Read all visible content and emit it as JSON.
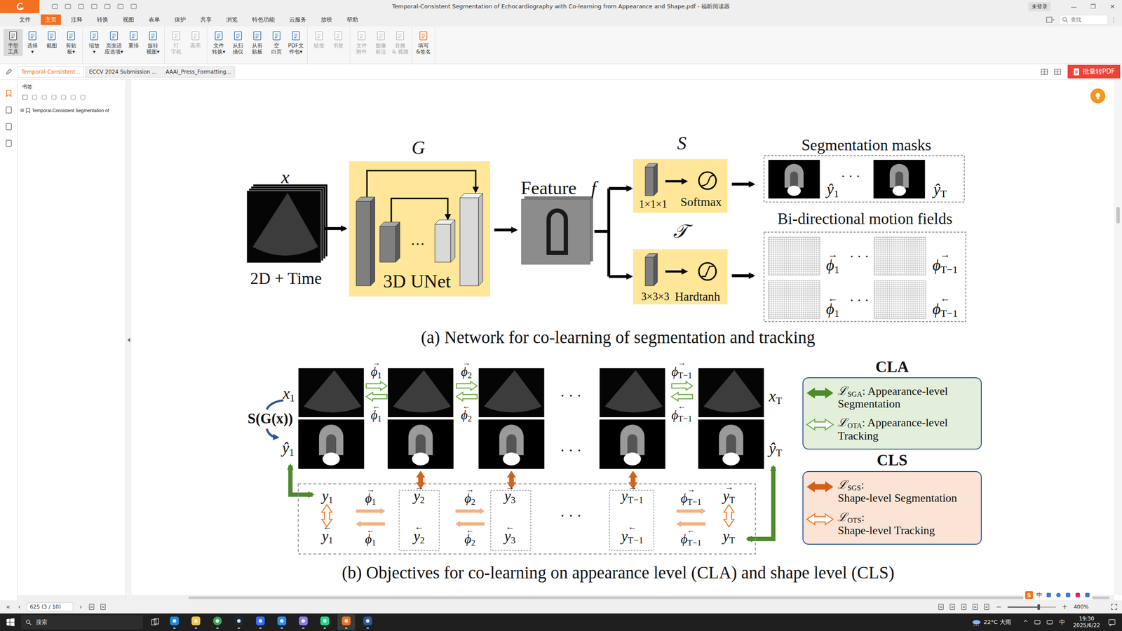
{
  "window": {
    "title": "Temporal-Consistent Segmentation of Echocardiography with Co-learning from Appearance and Shape.pdf - 福昕阅读器",
    "user": "未登录",
    "controls": [
      "—",
      "❐",
      "✕"
    ]
  },
  "menu": {
    "items": [
      {
        "label": "文件",
        "selected": false
      },
      {
        "label": "主页",
        "selected": true
      },
      {
        "label": "注释",
        "selected": false
      },
      {
        "label": "转换",
        "selected": false
      },
      {
        "label": "视图",
        "selected": false
      },
      {
        "label": "表单",
        "selected": false
      },
      {
        "label": "保护",
        "selected": false
      },
      {
        "label": "共享",
        "selected": false
      },
      {
        "label": "浏览",
        "selected": false
      },
      {
        "label": "特色功能",
        "selected": false
      },
      {
        "label": "云服务",
        "selected": false
      },
      {
        "label": "放映",
        "selected": false
      },
      {
        "label": "帮助",
        "selected": false
      }
    ],
    "search": {
      "placeholder": "查找"
    },
    "more": "⋮"
  },
  "ribbon": {
    "groups": [
      [
        {
          "lines": [
            "手型",
            "工具"
          ],
          "selected": true,
          "disabled": false
        },
        {
          "lines": [
            "选择",
            "▾"
          ],
          "selected": false,
          "disabled": false
        },
        {
          "lines": [
            "截图"
          ],
          "selected": false,
          "disabled": false
        },
        {
          "lines": [
            "剪贴",
            "板▾"
          ],
          "selected": false,
          "disabled": false
        }
      ],
      [
        {
          "lines": [
            "缩放",
            "▾"
          ],
          "selected": false,
          "disabled": false
        },
        {
          "lines": [
            "页面适",
            "应选项▾"
          ],
          "selected": false,
          "disabled": false
        },
        {
          "lines": [
            "重排"
          ],
          "selected": false,
          "disabled": false
        },
        {
          "lines": [
            "旋转",
            "视图▾"
          ],
          "selected": false,
          "disabled": false
        }
      ],
      [
        {
          "lines": [
            "打",
            "字机"
          ],
          "selected": false,
          "disabled": true
        },
        {
          "lines": [
            "高亮"
          ],
          "selected": false,
          "disabled": true
        }
      ],
      [
        {
          "lines": [
            "文件",
            "转换▾"
          ],
          "selected": false,
          "disabled": false
        },
        {
          "lines": [
            "从扫",
            "描仪"
          ],
          "selected": false,
          "disabled": false
        },
        {
          "lines": [
            "从剪",
            "贴板"
          ],
          "selected": false,
          "disabled": false
        },
        {
          "lines": [
            "空",
            "白页"
          ],
          "selected": false,
          "disabled": false
        },
        {
          "lines": [
            "PDF文",
            "件包▾"
          ],
          "selected": false,
          "disabled": false
        }
      ],
      [
        {
          "lines": [
            "链接"
          ],
          "selected": false,
          "disabled": true
        },
        {
          "lines": [
            "书签"
          ],
          "selected": false,
          "disabled": true
        }
      ],
      [
        {
          "lines": [
            "文件",
            "附件"
          ],
          "selected": false,
          "disabled": true
        },
        {
          "lines": [
            "图像",
            "标注"
          ],
          "selected": false,
          "disabled": true
        },
        {
          "lines": [
            "音频",
            "& 视频"
          ],
          "selected": false,
          "disabled": true
        }
      ],
      [
        {
          "lines": [
            "填写",
            "&签名"
          ],
          "selected": false,
          "disabled": false
        }
      ]
    ]
  },
  "tabs": {
    "items": [
      {
        "label": "Temporal-Consistent...",
        "selected": true
      },
      {
        "label": "ECCV 2024 Submission ...",
        "selected": false
      },
      {
        "label": "AAAI_Press_Formatting...",
        "selected": false
      }
    ],
    "convert_button": "批量转PDF"
  },
  "sidebar": {
    "panel_title": "书签",
    "tree": [
      {
        "label": "Temporal-Consistent Segmentation of",
        "expander": "⊞",
        "expanded": false
      }
    ]
  },
  "figure": {
    "a": {
      "input_symbol": "x",
      "input_label": "2D + Time",
      "g_symbol": "G",
      "unet_label": "3D UNet",
      "unet_dots": "…",
      "feature_label": "Feature",
      "feature_symbol": "f",
      "s_symbol": "S",
      "s_kernel": "1×1×1",
      "s_activation": "Softmax",
      "t_symbol": "𝒯",
      "t_kernel": "3×3×3",
      "t_activation": "Hardtanh",
      "seg_title": "Segmentation masks",
      "seg_first": {
        "sym": "ŷ",
        "sub": "1"
      },
      "seg_dots": "· · ·",
      "seg_last": {
        "sym": "ŷ",
        "sub": "T"
      },
      "motion_title": "Bi-directional motion fields",
      "motion_rows": [
        {
          "first": {
            "arrow": "→",
            "sym": "ϕ",
            "sub": "1"
          },
          "dots": "· · ·",
          "last": {
            "arrow": "→",
            "sym": "ϕ",
            "sub": "T−1"
          }
        },
        {
          "first": {
            "arrow": "←",
            "sym": "ϕ",
            "sub": "1"
          },
          "dots": "· · ·",
          "last": {
            "arrow": "←",
            "sym": "ϕ",
            "sub": "T−1"
          }
        }
      ],
      "caption": "(a) Network for co-learning of segmentation and tracking"
    },
    "b": {
      "x_first": {
        "sym": "x",
        "sub": "1"
      },
      "x_last": {
        "sym": "x",
        "sub": "T"
      },
      "y_first": {
        "sym": "ŷ",
        "sub": "1"
      },
      "y_last": {
        "sym": "ŷ",
        "sub": "T"
      },
      "sg_label": "S(G(x))",
      "top_links": [
        {
          "fwd": {
            "arrow": "→",
            "sym": "ϕ",
            "sub": "1"
          },
          "bwd": {
            "arrow": "←",
            "sym": "ϕ",
            "sub": "1"
          }
        },
        {
          "fwd": {
            "arrow": "→",
            "sym": "ϕ",
            "sub": "2"
          },
          "bwd": {
            "arrow": "←",
            "sym": "ϕ",
            "sub": "2"
          }
        },
        {
          "fwd": {
            "arrow": "→",
            "sym": "ϕ",
            "sub": "T−1"
          },
          "bwd": {
            "arrow": "←",
            "sym": "ϕ",
            "sub": "T−1"
          }
        }
      ],
      "dots": [
        "· · ·",
        "· · ·",
        "· · ·"
      ],
      "shape_columns": [
        {
          "top": {
            "sym": "y",
            "sub": "1"
          },
          "bottom": {
            "arrow": "←",
            "sym": "y",
            "sub": "1"
          }
        },
        {
          "top": {
            "arrow": "→",
            "sym": "y",
            "sub": "2"
          },
          "bottom": {
            "arrow": "←",
            "sym": "y",
            "sub": "2"
          }
        },
        {
          "top": {
            "arrow": "→",
            "sym": "y",
            "sub": "3"
          },
          "bottom": {
            "arrow": "←",
            "sym": "y",
            "sub": "3"
          }
        },
        {
          "top": {
            "arrow": "→",
            "sym": "y",
            "sub": "T−1"
          },
          "bottom": {
            "arrow": "←",
            "sym": "y",
            "sub": "T−1"
          }
        },
        {
          "top": {
            "arrow": "→",
            "sym": "y",
            "sub": "T"
          },
          "bottom": {
            "sym": "y",
            "sub": "T"
          }
        }
      ],
      "shape_links": [
        {
          "fwd": {
            "arrow": "→",
            "sym": "ϕ",
            "sub": "1"
          },
          "bwd": {
            "arrow": "←",
            "sym": "ϕ",
            "sub": "1"
          }
        },
        {
          "fwd": {
            "arrow": "→",
            "sym": "ϕ",
            "sub": "2"
          },
          "bwd": {
            "arrow": "←",
            "sym": "ϕ",
            "sub": "2"
          }
        },
        {
          "fwd": {
            "arrow": "→",
            "sym": "ϕ",
            "sub": "T−1"
          },
          "bwd": {
            "arrow": "←",
            "sym": "ϕ",
            "sub": "T−1"
          }
        }
      ],
      "legends": [
        {
          "title": "CLA",
          "color": "#e2efda",
          "items": [
            {
              "sym": "ℒ",
              "sub": "SGA",
              "line1": ": Appearance-level",
              "line2": "Segmentation",
              "kind": "solid",
              "color": "#4e8a2c"
            },
            {
              "sym": "ℒ",
              "sub": "OTA",
              "line1": ": Appearance-level",
              "line2": "Tracking",
              "kind": "hollow",
              "color": "#70ad47"
            }
          ]
        },
        {
          "title": "CLS",
          "color": "#fbe3d5",
          "items": [
            {
              "sym": "ℒ",
              "sub": "SGS",
              "line1": ":",
              "line2": "Shape-level Segmentation",
              "kind": "solid",
              "color": "#d4601a"
            },
            {
              "sym": "ℒ",
              "sub": "OTS",
              "line1": ":",
              "line2": "Shape-level Tracking",
              "kind": "hollow",
              "color": "#ed7d31"
            }
          ]
        }
      ],
      "caption": "(b) Objectives for co-learning on appearance level (CLA) and shape level (CLS)"
    }
  },
  "status": {
    "first": "«",
    "prev": "‹",
    "page": "625 (3 / 10)",
    "next": "›",
    "zoom": {
      "minus": "−",
      "plus": "+",
      "level": 0.64,
      "reading": "400%"
    }
  },
  "taskbar": {
    "search": {
      "placeholder": "搜索"
    },
    "apps": [
      {
        "running": true,
        "selected": false
      },
      {
        "running": true,
        "selected": false
      },
      {
        "running": true,
        "selected": false
      },
      {
        "running": true,
        "selected": false
      },
      {
        "running": true,
        "selected": false
      },
      {
        "running": true,
        "selected": false
      },
      {
        "running": true,
        "selected": false
      },
      {
        "running": true,
        "selected": false
      },
      {
        "running": true,
        "selected": true
      },
      {
        "running": true,
        "selected": false
      }
    ],
    "weather": "22°C 大雨",
    "tray_up": "^",
    "ime": "中",
    "time": "19:30",
    "date": "2025/6/22"
  },
  "ime_bar": {
    "logo": "S",
    "lang": "中"
  }
}
